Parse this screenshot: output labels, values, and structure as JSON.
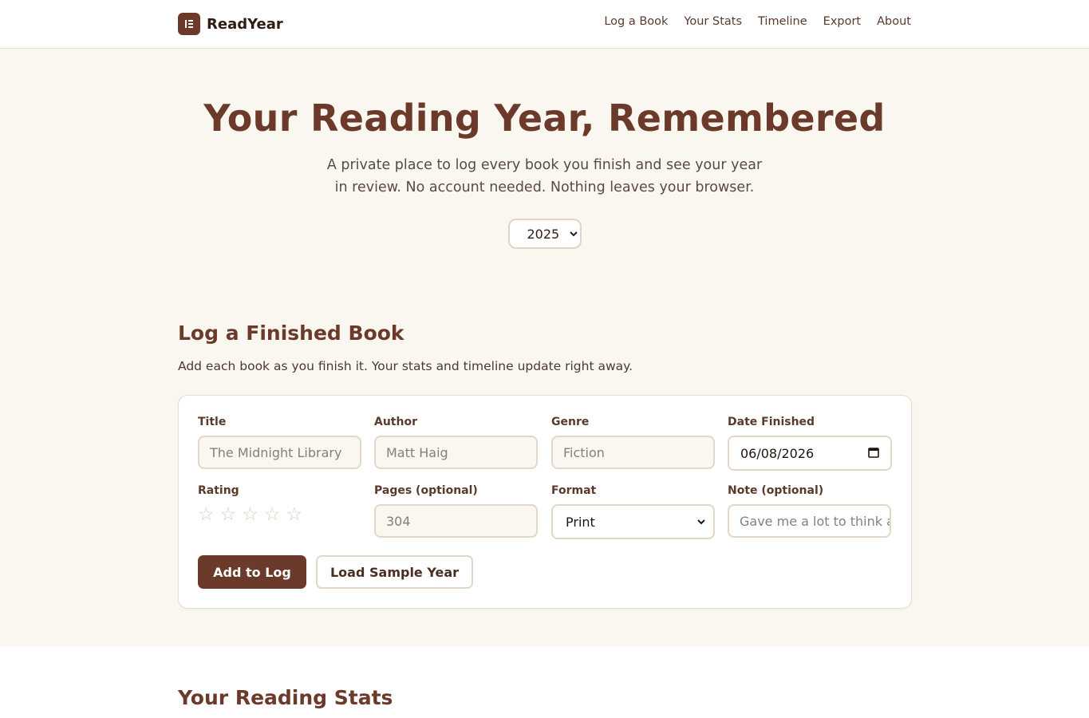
{
  "brand": {
    "name": "ReadYear",
    "logo_icon": "book-icon"
  },
  "nav": {
    "items": [
      {
        "label": "Log a Book"
      },
      {
        "label": "Your Stats"
      },
      {
        "label": "Timeline"
      },
      {
        "label": "Export"
      },
      {
        "label": "About"
      }
    ]
  },
  "hero": {
    "title": "Your Reading Year, Remembered",
    "subtitle": "A private place to log every book you finish and see your year in review. No account needed. Nothing leaves your browser.",
    "year_selected": "2025"
  },
  "log_section": {
    "title": "Log a Finished Book",
    "subtitle": "Add each book as you finish it. Your stats and timeline update right away."
  },
  "form": {
    "title_label": "Title",
    "title_placeholder": "The Midnight Library",
    "author_label": "Author",
    "author_placeholder": "Matt Haig",
    "genre_label": "Genre",
    "genre_placeholder": "Fiction",
    "date_label": "Date Finished",
    "date_value": "06/08/2026",
    "rating_label": "Rating",
    "rating_value": 0,
    "rating_max": 5,
    "star_glyph": "☆",
    "pages_label": "Pages (optional)",
    "pages_placeholder": "304",
    "format_label": "Format",
    "format_value": "Print",
    "note_label": "Note (optional)",
    "note_placeholder": "Gave me a lot to think about",
    "add_button": "Add to Log",
    "sample_button": "Load Sample Year"
  },
  "stats_section": {
    "title": "Your Reading Stats"
  },
  "colors": {
    "accent": "#6b3a2a",
    "background": "#faf6f0",
    "card": "#ffffff",
    "border": "#e2d7c9"
  }
}
